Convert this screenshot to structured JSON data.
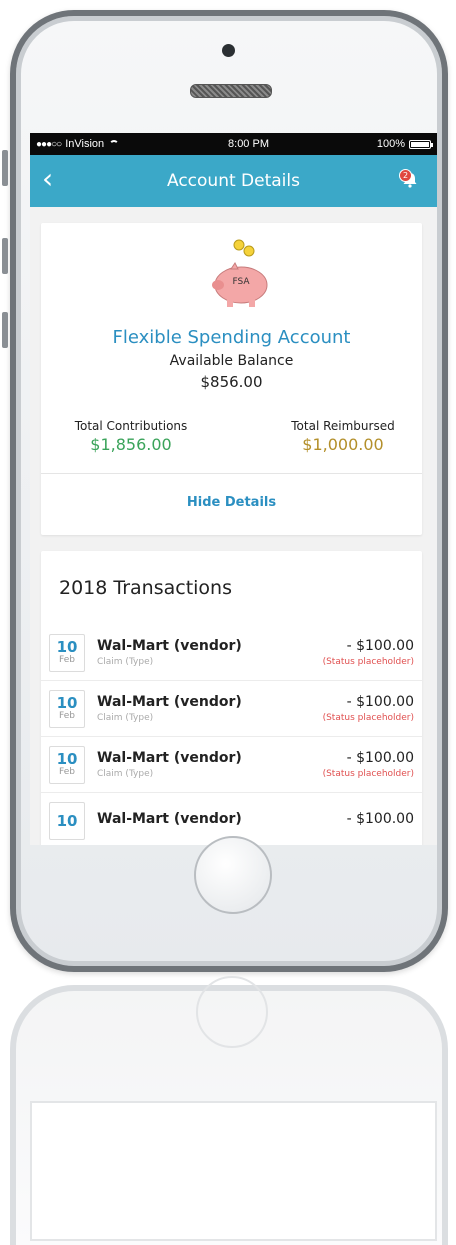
{
  "statusbar": {
    "carrier": "InVision",
    "time": "8:00 PM",
    "battery": "100%",
    "signal_dots": "●●●○○"
  },
  "navbar": {
    "back_glyph": "‹",
    "title": "Account Details",
    "notification_count": "2"
  },
  "account": {
    "piggy_label": "FSA",
    "name": "Flexible Spending Account",
    "available_label": "Available Balance",
    "available_value": "$856.00",
    "contributions_label": "Total Contributions",
    "contributions_value": "$1,856.00",
    "reimbursed_label": "Total Reimbursed",
    "reimbursed_value": "$1,000.00",
    "hide_details": "Hide Details"
  },
  "transactions": {
    "title": "2018 Transactions",
    "items": [
      {
        "day": "10",
        "month": "Feb",
        "vendor": "Wal-Mart (vendor)",
        "type": "Claim (Type)",
        "amount": "- $100.00",
        "status": "(Status placeholder)"
      },
      {
        "day": "10",
        "month": "Feb",
        "vendor": "Wal-Mart (vendor)",
        "type": "Claim (Type)",
        "amount": "- $100.00",
        "status": "(Status placeholder)"
      },
      {
        "day": "10",
        "month": "Feb",
        "vendor": "Wal-Mart (vendor)",
        "type": "Claim (Type)",
        "amount": "- $100.00",
        "status": "(Status placeholder)"
      },
      {
        "day": "10",
        "month": "",
        "vendor": "Wal-Mart (vendor)",
        "type": "",
        "amount": "- $100.00",
        "status": ""
      }
    ]
  },
  "colors": {
    "accent": "#3ba8c8",
    "link": "#2b8fc1",
    "positive": "#3aa35a",
    "reimbursed": "#b38f2a",
    "status": "#e05050"
  },
  "icons": {
    "back": "chevron-left-icon",
    "notification": "bell-icon",
    "wifi": "wifi-icon",
    "battery": "battery-icon",
    "piggy": "piggy-bank-icon"
  }
}
